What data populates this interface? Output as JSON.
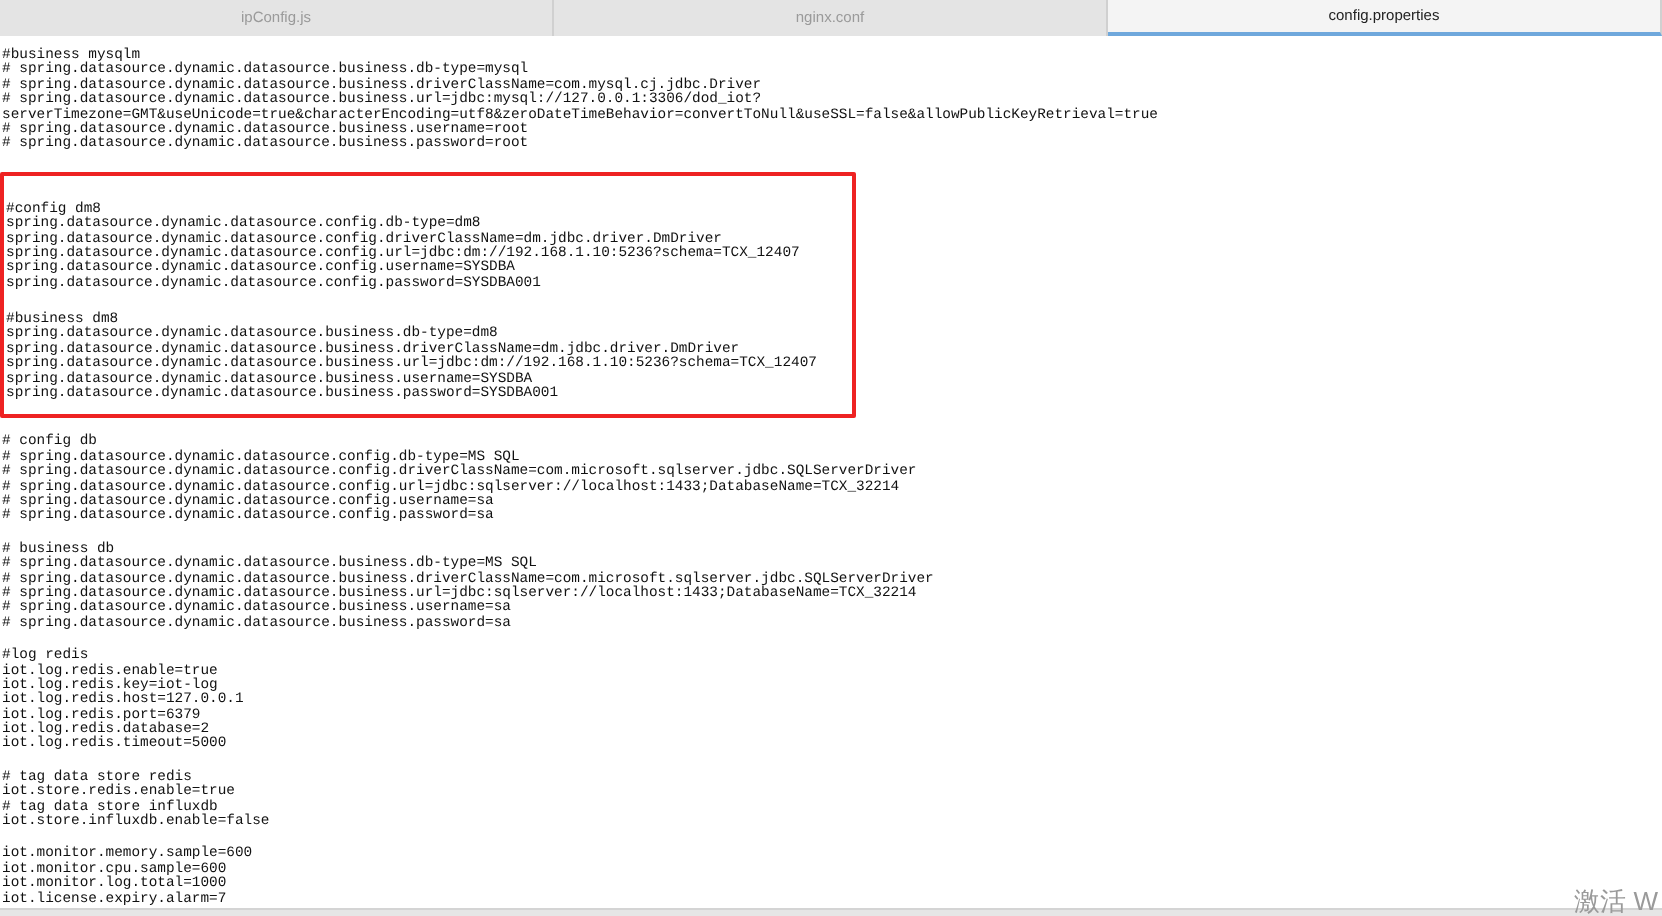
{
  "tabs": [
    {
      "label": "ipConfig.js",
      "selected": false
    },
    {
      "label": "nginx.conf",
      "selected": false
    },
    {
      "label": "config.properties",
      "selected": true
    }
  ],
  "editor": {
    "sections": [
      {
        "kind": "block",
        "lines": [
          "#business mysqlm",
          "# spring.datasource.dynamic.datasource.business.db-type=mysql",
          "# spring.datasource.dynamic.datasource.business.driverClassName=com.mysql.cj.jdbc.Driver",
          "# spring.datasource.dynamic.datasource.business.url=jdbc:mysql://127.0.0.1:3306/dod_iot?",
          "serverTimezone=GMT&useUnicode=true&characterEncoding=utf8&zeroDateTimeBehavior=convertToNull&useSSL=false&allowPublicKeyRetrieval=true",
          "# spring.datasource.dynamic.datasource.business.username=root",
          "# spring.datasource.dynamic.datasource.business.password=root"
        ]
      },
      {
        "kind": "highlight",
        "blocks": [
          {
            "lines": [
              "#config dm8",
              "spring.datasource.dynamic.datasource.config.db-type=dm8",
              "spring.datasource.dynamic.datasource.config.driverClassName=dm.jdbc.driver.DmDriver",
              "spring.datasource.dynamic.datasource.config.url=jdbc:dm://192.168.1.10:5236?schema=TCX_12407",
              "spring.datasource.dynamic.datasource.config.username=SYSDBA",
              "spring.datasource.dynamic.datasource.config.password=SYSDBA001"
            ]
          },
          {
            "lines": [
              "#business dm8",
              "spring.datasource.dynamic.datasource.business.db-type=dm8",
              "spring.datasource.dynamic.datasource.business.driverClassName=dm.jdbc.driver.DmDriver",
              "spring.datasource.dynamic.datasource.business.url=jdbc:dm://192.168.1.10:5236?schema=TCX_12407",
              "spring.datasource.dynamic.datasource.business.username=SYSDBA",
              "spring.datasource.dynamic.datasource.business.password=SYSDBA001"
            ]
          }
        ]
      },
      {
        "kind": "block",
        "lines": [
          "# config db",
          "# spring.datasource.dynamic.datasource.config.db-type=MS SQL",
          "# spring.datasource.dynamic.datasource.config.driverClassName=com.microsoft.sqlserver.jdbc.SQLServerDriver",
          "# spring.datasource.dynamic.datasource.config.url=jdbc:sqlserver://localhost:1433;DatabaseName=TCX_32214",
          "# spring.datasource.dynamic.datasource.config.username=sa",
          "# spring.datasource.dynamic.datasource.config.password=sa"
        ]
      },
      {
        "kind": "block",
        "lines": [
          "# business db",
          "# spring.datasource.dynamic.datasource.business.db-type=MS SQL",
          "# spring.datasource.dynamic.datasource.business.driverClassName=com.microsoft.sqlserver.jdbc.SQLServerDriver",
          "# spring.datasource.dynamic.datasource.business.url=jdbc:sqlserver://localhost:1433;DatabaseName=TCX_32214",
          "# spring.datasource.dynamic.datasource.business.username=sa",
          "# spring.datasource.dynamic.datasource.business.password=sa"
        ]
      },
      {
        "kind": "block",
        "lines": [
          "#log redis",
          "iot.log.redis.enable=true",
          "iot.log.redis.key=iot-log",
          "iot.log.redis.host=127.0.0.1",
          "iot.log.redis.port=6379",
          "iot.log.redis.database=2",
          "iot.log.redis.timeout=5000"
        ]
      },
      {
        "kind": "block",
        "lines": [
          "# tag data store redis",
          "iot.store.redis.enable=true",
          "# tag data store influxdb",
          "iot.store.influxdb.enable=false"
        ]
      },
      {
        "kind": "block",
        "lines": [
          "iot.monitor.memory.sample=600",
          "iot.monitor.cpu.sample=600",
          "iot.monitor.log.total=1000",
          "iot.license.expiry.alarm=7"
        ]
      }
    ]
  },
  "activation_notice": "激活 W"
}
